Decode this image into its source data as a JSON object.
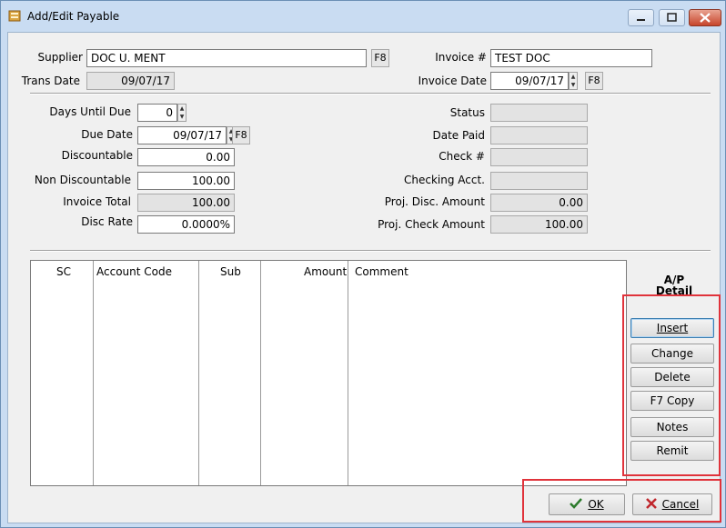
{
  "window": {
    "title": "Add/Edit Payable"
  },
  "header": {
    "supplier_label": "Supplier",
    "supplier_value": "DOC U. MENT",
    "supplier_f8": "F8",
    "invoice_label": "Invoice #",
    "invoice_value": "TEST DOC",
    "trans_date_label": "Trans Date",
    "trans_date_value": "09/07/17",
    "invoice_date_label": "Invoice Date",
    "invoice_date_value": "09/07/17",
    "invoice_date_f8": "F8"
  },
  "left": {
    "days_until_due_label": "Days Until Due",
    "days_until_due_value": "0",
    "due_date_label": "Due Date",
    "due_date_value": "09/07/17",
    "due_date_f8": "F8",
    "discountable_label": "Discountable",
    "discountable_value": "0.00",
    "non_discountable_label": "Non Discountable",
    "non_discountable_value": "100.00",
    "invoice_total_label": "Invoice Total",
    "invoice_total_value": "100.00",
    "disc_rate_label": "Disc Rate",
    "disc_rate_value": "0.0000%"
  },
  "right": {
    "status_label": "Status",
    "status_value": "",
    "date_paid_label": "Date Paid",
    "date_paid_value": "",
    "check_label": "Check #",
    "check_value": "",
    "checking_acct_label": "Checking Acct.",
    "checking_acct_value": "",
    "proj_disc_label": "Proj. Disc. Amount",
    "proj_disc_value": "0.00",
    "proj_check_label": "Proj. Check Amount",
    "proj_check_value": "100.00"
  },
  "grid": {
    "columns": [
      "SC",
      "Account Code",
      "Sub",
      "Amount",
      "Comment"
    ]
  },
  "detail": {
    "title_line1": "A/P",
    "title_line2": "Detail",
    "insert": "Insert",
    "change": "Change",
    "delete": "Delete",
    "copy": "F7 Copy",
    "notes": "Notes",
    "remit": "Remit"
  },
  "footer": {
    "ok": "OK",
    "cancel": "Cancel"
  },
  "colors": {
    "highlight": "#e0333b",
    "titlebar": "#c9dcf2"
  }
}
